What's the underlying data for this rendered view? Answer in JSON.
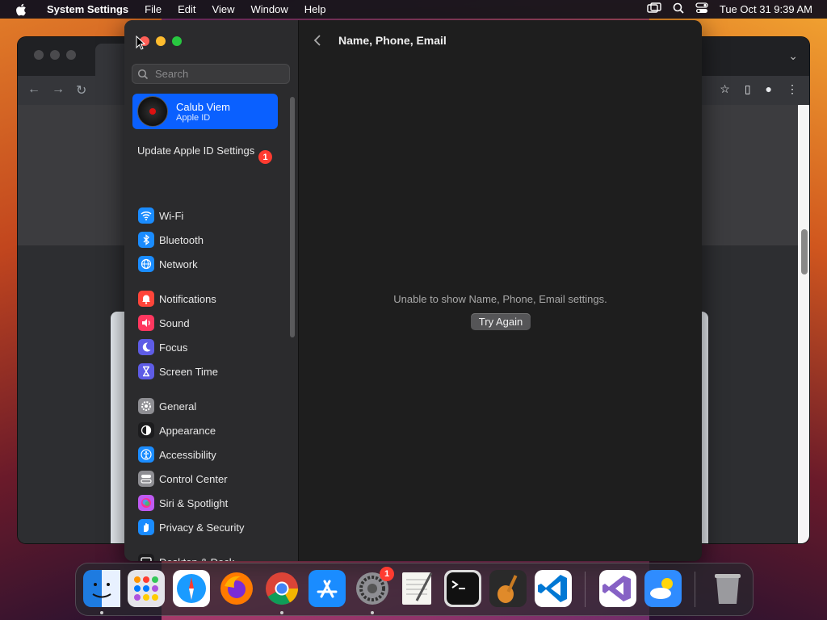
{
  "menubar": {
    "app_name": "System Settings",
    "menus": [
      "File",
      "Edit",
      "View",
      "Window",
      "Help"
    ],
    "clock": "Tue Oct 31  9:39 AM"
  },
  "settings": {
    "search": {
      "placeholder": "Search",
      "value": ""
    },
    "account": {
      "name": "Calub Viem",
      "subtitle": "Apple ID"
    },
    "update": {
      "label": "Update Apple ID Settings",
      "badge": "1"
    },
    "sidebar_items": [
      {
        "label": "Wi-Fi",
        "icon": "wifi-icon",
        "color": "#1a8cff"
      },
      {
        "label": "Bluetooth",
        "icon": "bluetooth-icon",
        "color": "#1a8cff"
      },
      {
        "label": "Network",
        "icon": "globe-icon",
        "color": "#1a8cff"
      },
      {
        "label": "Notifications",
        "icon": "bell-icon",
        "color": "#ff453a"
      },
      {
        "label": "Sound",
        "icon": "speaker-icon",
        "color": "#ff375f"
      },
      {
        "label": "Focus",
        "icon": "moon-icon",
        "color": "#5e5ce6"
      },
      {
        "label": "Screen Time",
        "icon": "hourglass-icon",
        "color": "#5e5ce6"
      },
      {
        "label": "General",
        "icon": "gear-icon",
        "color": "#8e8e93"
      },
      {
        "label": "Appearance",
        "icon": "appearance-icon",
        "color": "#1c1c1e"
      },
      {
        "label": "Accessibility",
        "icon": "accessibility-icon",
        "color": "#1a8cff"
      },
      {
        "label": "Control Center",
        "icon": "control-center-icon",
        "color": "#8e8e93"
      },
      {
        "label": "Siri & Spotlight",
        "icon": "siri-icon",
        "color": "#bf5af2"
      },
      {
        "label": "Privacy & Security",
        "icon": "hand-icon",
        "color": "#1a8cff"
      },
      {
        "label": "Desktop & Dock",
        "icon": "dock-icon",
        "color": "#1c1c1e"
      }
    ],
    "detail": {
      "title": "Name, Phone, Email",
      "message": "Unable to show Name, Phone, Email settings.",
      "button": "Try Again"
    }
  },
  "dock": {
    "apps": [
      {
        "name": "finder-icon",
        "color": "#1e7be0"
      },
      {
        "name": "launchpad-icon",
        "color": "#e5e5ea"
      },
      {
        "name": "safari-icon",
        "color": "#ffffff"
      },
      {
        "name": "firefox-icon",
        "color": "#ff7a00"
      },
      {
        "name": "chrome-icon",
        "color": "#ffffff"
      },
      {
        "name": "app-store-icon",
        "color": "#1a8cff"
      },
      {
        "name": "system-settings-icon",
        "color": "#8e8e93",
        "badge": "1"
      },
      {
        "name": "textedit-icon",
        "color": "#f5f5f0"
      },
      {
        "name": "terminal-icon",
        "color": "#111111"
      },
      {
        "name": "garageband-icon",
        "color": "#2a2a2a"
      },
      {
        "name": "vscode-icon",
        "color": "#ffffff"
      },
      {
        "name": "visual-studio-icon",
        "color": "#ffffff"
      },
      {
        "name": "weather-icon",
        "color": "#2f8cff"
      },
      {
        "name": "trash-icon",
        "color": "#9a9a9e"
      }
    ]
  }
}
